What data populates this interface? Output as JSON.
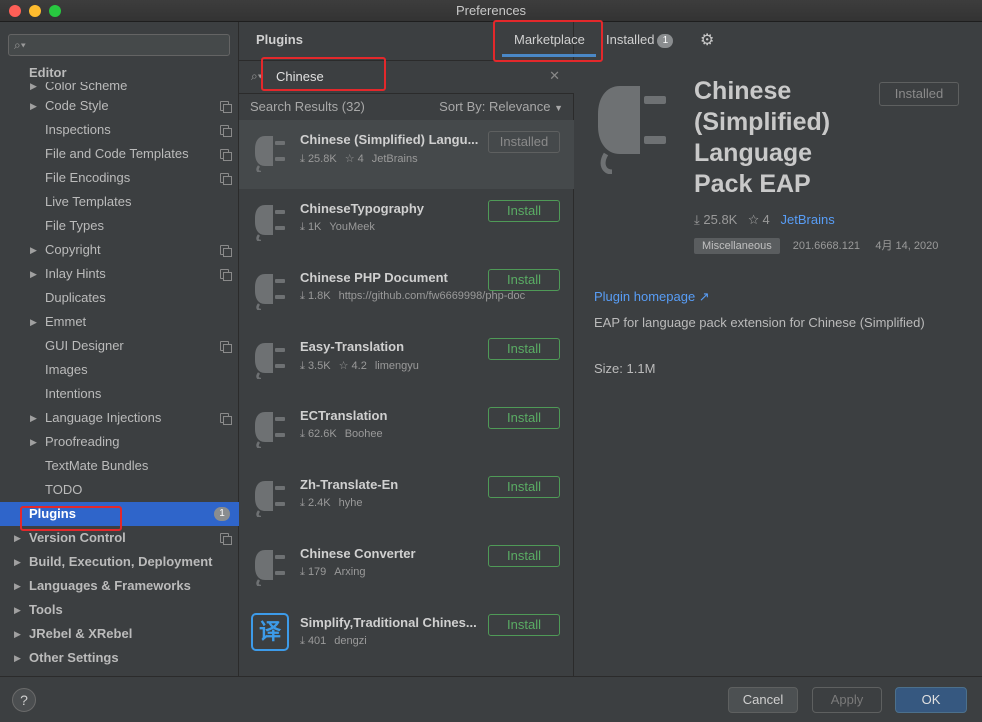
{
  "window": {
    "title": "Preferences"
  },
  "sidebar": {
    "search_placeholder": "",
    "items": [
      {
        "label": "Editor",
        "level": 0,
        "bold": true
      },
      {
        "label": "Color Scheme",
        "level": 1,
        "arrow": true
      },
      {
        "label": "Code Style",
        "level": 1,
        "arrow": true,
        "page": true
      },
      {
        "label": "Inspections",
        "level": 1,
        "page": true
      },
      {
        "label": "File and Code Templates",
        "level": 1,
        "page": true
      },
      {
        "label": "File Encodings",
        "level": 1,
        "page": true
      },
      {
        "label": "Live Templates",
        "level": 1
      },
      {
        "label": "File Types",
        "level": 1
      },
      {
        "label": "Copyright",
        "level": 1,
        "arrow": true,
        "page": true
      },
      {
        "label": "Inlay Hints",
        "level": 1,
        "arrow": true,
        "page": true
      },
      {
        "label": "Duplicates",
        "level": 1
      },
      {
        "label": "Emmet",
        "level": 1,
        "arrow": true
      },
      {
        "label": "GUI Designer",
        "level": 1,
        "page": true
      },
      {
        "label": "Images",
        "level": 1
      },
      {
        "label": "Intentions",
        "level": 1
      },
      {
        "label": "Language Injections",
        "level": 1,
        "arrow": true,
        "page": true
      },
      {
        "label": "Proofreading",
        "level": 1,
        "arrow": true
      },
      {
        "label": "TextMate Bundles",
        "level": 1
      },
      {
        "label": "TODO",
        "level": 1
      },
      {
        "label": "Plugins",
        "level": 0,
        "bold": true,
        "selected": true,
        "badge": "1"
      },
      {
        "label": "Version Control",
        "level": 0,
        "bold": true,
        "arrow": true,
        "page": true
      },
      {
        "label": "Build, Execution, Deployment",
        "level": 0,
        "bold": true,
        "arrow": true
      },
      {
        "label": "Languages & Frameworks",
        "level": 0,
        "bold": true,
        "arrow": true
      },
      {
        "label": "Tools",
        "level": 0,
        "bold": true,
        "arrow": true
      },
      {
        "label": "JRebel & XRebel",
        "level": 0,
        "bold": true,
        "arrow": true
      },
      {
        "label": "Other Settings",
        "level": 0,
        "bold": true,
        "arrow": true
      }
    ]
  },
  "plugins_panel": {
    "title": "Plugins",
    "tabs": {
      "marketplace": "Marketplace",
      "installed": "Installed",
      "installed_count": "1"
    },
    "search_value": "Chinese",
    "results_label": "Search Results (32)",
    "sort_label": "Sort By: Relevance",
    "results": [
      {
        "name": "Chinese (Simplified) Langu...",
        "downloads": "25.8K",
        "rating": "4",
        "vendor": "JetBrains",
        "action": "Installed",
        "icon": "plug-icon"
      },
      {
        "name": "ChineseTypography",
        "downloads": "1K",
        "rating": "",
        "vendor": "YouMeek",
        "action": "Install",
        "icon": "plug-icon"
      },
      {
        "name": "Chinese PHP Document",
        "downloads": "1.8K",
        "rating": "",
        "vendor": "https://github.com/fw6669998/php-doc",
        "action": "Install",
        "icon": "plug-icon"
      },
      {
        "name": "Easy-Translation",
        "downloads": "3.5K",
        "rating": "4.2",
        "vendor": "limengyu",
        "action": "Install",
        "icon": "plug-icon"
      },
      {
        "name": "ECTranslation",
        "downloads": "62.6K",
        "rating": "",
        "vendor": "Boohee",
        "action": "Install",
        "icon": "plug-icon"
      },
      {
        "name": "Zh-Translate-En",
        "downloads": "2.4K",
        "rating": "",
        "vendor": "hyhe",
        "action": "Install",
        "icon": "plug-icon"
      },
      {
        "name": "Chinese Converter",
        "downloads": "179",
        "rating": "",
        "vendor": "Arxing",
        "action": "Install",
        "icon": "plug-icon"
      },
      {
        "name": "Simplify,Traditional Chines...",
        "downloads": "401",
        "rating": "",
        "vendor": "dengzi",
        "action": "Install",
        "icon": "translate-icon",
        "icon_text": "译"
      }
    ]
  },
  "detail": {
    "name": "Chinese (Simplified) Language Pack EAP",
    "status_button": "Installed",
    "downloads": "25.8K",
    "rating": "4",
    "vendor": "JetBrains",
    "tag": "Miscellaneous",
    "version": "201.6668.121",
    "date": "4月 14, 2020",
    "homepage": "Plugin homepage ↗",
    "description": "EAP for language pack extension for Chinese (Simplified)",
    "size": "Size: 1.1M"
  },
  "footer": {
    "help": "?",
    "cancel": "Cancel",
    "apply": "Apply",
    "ok": "OK"
  },
  "colors": {
    "accent": "#2f65ca",
    "install_green": "#5aac64",
    "link": "#589df6",
    "highlight": "#e3282b"
  }
}
